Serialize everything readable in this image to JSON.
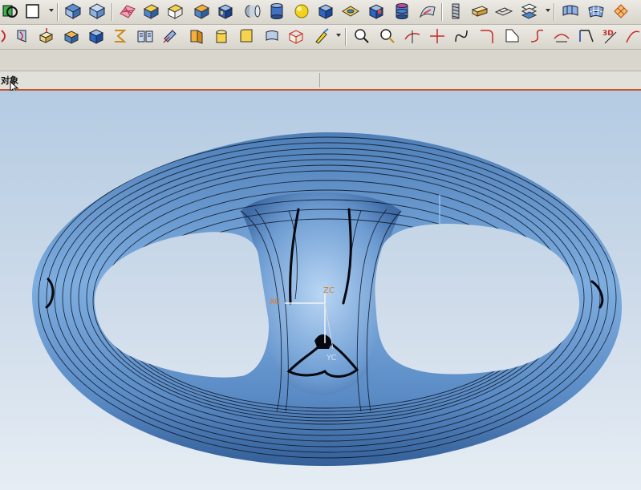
{
  "navigator": {
    "title": "对象"
  },
  "toolbar": {
    "row1": [
      {
        "icon": "select-filter-icon"
      },
      {
        "icon": "rectangle-icon"
      },
      {
        "icon": "view-fit-icon"
      },
      {
        "icon": "view-orient-icon"
      },
      {
        "icon": "mesh-surface-icon"
      },
      {
        "icon": "block-feature-icon"
      },
      {
        "icon": "wire-block-icon"
      },
      {
        "icon": "solid-block-icon"
      },
      {
        "icon": "cube-blue-icon"
      },
      {
        "icon": "cylinder-icon"
      },
      {
        "icon": "tube-icon"
      },
      {
        "icon": "sphere-icon"
      },
      {
        "icon": "box-icon"
      },
      {
        "icon": "sheet-icon"
      },
      {
        "icon": "pocket-icon"
      },
      {
        "icon": "db-cylinder-icon"
      },
      {
        "icon": "swept-surface-icon"
      },
      {
        "icon": "spring-icon"
      },
      {
        "icon": "slab-icon"
      },
      {
        "icon": "plate-icon"
      },
      {
        "icon": "stack-icon"
      },
      {
        "icon": "ribbon-surface-icon"
      },
      {
        "icon": "grid-surface-icon"
      },
      {
        "icon": "patch-surface-icon"
      }
    ],
    "row2": [
      {
        "icon": "curve-arc-icon"
      },
      {
        "icon": "twist-icon"
      },
      {
        "icon": "scale-body-icon"
      },
      {
        "icon": "trim-body-icon"
      },
      {
        "icon": "hollow-icon"
      },
      {
        "icon": "wrap-icon"
      },
      {
        "icon": "book-icon"
      },
      {
        "icon": "offset-face-icon"
      },
      {
        "icon": "half-solid-icon"
      },
      {
        "icon": "draft-face-icon"
      },
      {
        "icon": "blend-face-icon"
      },
      {
        "icon": "surface-sew-icon"
      },
      {
        "icon": "frame-cube-icon"
      },
      {
        "icon": "brush-icon"
      },
      {
        "icon": "analyze-icon"
      },
      {
        "icon": "measure-icon"
      },
      {
        "icon": "curve-split-icon"
      },
      {
        "icon": "point-cross-icon"
      },
      {
        "icon": "curve-s-icon"
      },
      {
        "icon": "fillet-curve-icon"
      },
      {
        "icon": "chamfer-curve-icon"
      },
      {
        "icon": "spline-icon"
      },
      {
        "icon": "bridge-curve-icon"
      },
      {
        "icon": "curve-trim-icon"
      },
      {
        "icon": "3d-curve-icon"
      },
      {
        "icon": "intersect-curve-icon"
      }
    ]
  },
  "viewport": {
    "background_top": "#b4cbe2",
    "background_bottom": "#e6edf4",
    "model_color": "#6f9fd2",
    "contour_color": "#0b1320",
    "csys": {
      "zc_label": "ZC",
      "xc_label": "XC",
      "yc_label": "YC",
      "label_color": "#e07a28"
    }
  }
}
